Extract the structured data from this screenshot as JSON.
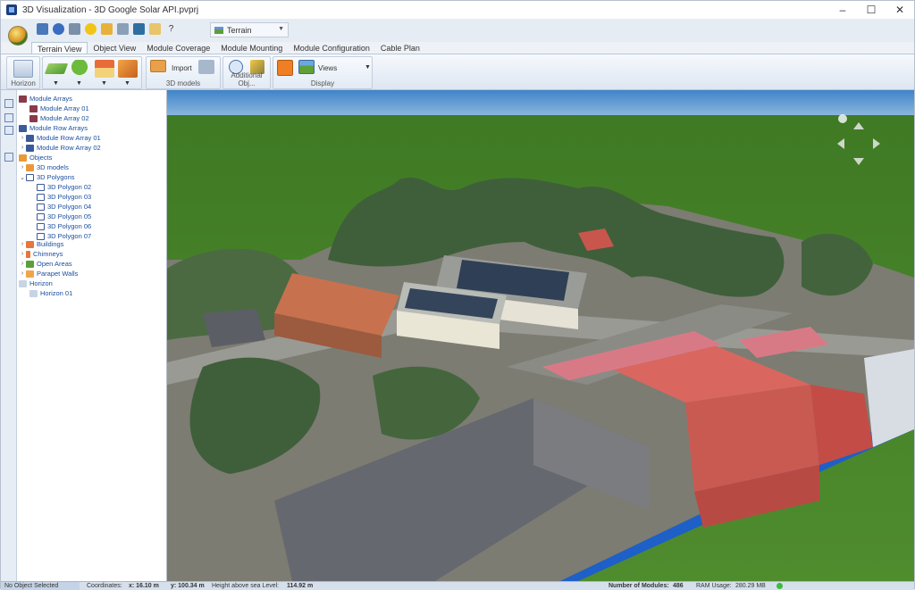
{
  "window": {
    "title": "3D Visualization - 3D Google Solar API.pvprj",
    "controls": [
      "–",
      "☐",
      "✕"
    ]
  },
  "quick_access": {
    "terrain_combo": "Terrain"
  },
  "tabs": [
    {
      "label": "Terrain View",
      "active": true
    },
    {
      "label": "Object View"
    },
    {
      "label": "Module Coverage"
    },
    {
      "label": "Module Mounting"
    },
    {
      "label": "Module Configuration"
    },
    {
      "label": "Cable Plan"
    }
  ],
  "ribbon": {
    "horizon_label": "Horizon",
    "import_label": "Import",
    "group_3d_models": "3D models",
    "group_additional": "Additional Obj...",
    "views_label": "Views",
    "group_display": "Display"
  },
  "tree": {
    "module_arrays": "Module Arrays",
    "module_array_01": "Module Array 01",
    "module_array_02": "Module Array 02",
    "module_row_arrays": "Module Row Arrays",
    "module_row_array_01": "Module Row Array 01",
    "module_row_array_02": "Module Row Array 02",
    "objects": "Objects",
    "models_3d": "3D models",
    "polygons_3d": "3D Polygons",
    "polygons": [
      "3D Polygon 02",
      "3D Polygon 03",
      "3D Polygon 04",
      "3D Polygon 05",
      "3D Polygon 06",
      "3D Polygon 07"
    ],
    "buildings": "Buildings",
    "chimneys": "Chimneys",
    "open_areas": "Open Areas",
    "parapet_walls": "Parapet Walls",
    "horizon": "Horizon",
    "horizon_01": "Horizon 01"
  },
  "status": {
    "selection": "No Object Selected",
    "coordinates_label": "Coordinates:",
    "x_value": "x: 16.10 m",
    "y_value": "y: 100.34 m",
    "height_label": "Height above sea Level:",
    "height_value": "114.92 m",
    "modules_label": "Number of Modules:",
    "modules_value": "486",
    "ram_label": "RAM Usage:",
    "ram_value": "280.29 MB"
  },
  "colors": {
    "sky": "#3f84c9",
    "grass": "#4f8c2e",
    "roof_red": "#d9675f",
    "tree_dark": "#3f5f3a"
  }
}
